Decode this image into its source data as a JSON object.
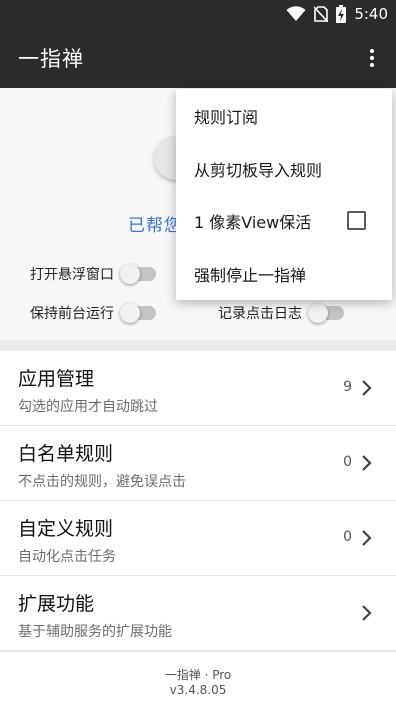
{
  "status_bar": {
    "time": "5:40",
    "icons": [
      "wifi-icon",
      "no-sim-icon",
      "battery-charging-icon"
    ]
  },
  "app_bar": {
    "title": "一指禅",
    "more_icon": "more-vert-icon"
  },
  "main": {
    "helped_text": "已帮您",
    "settings": {
      "floating_window": "打开悬浮窗口",
      "keep_foreground": "保持前台运行",
      "log_clicks": "记录点击日志"
    }
  },
  "list": [
    {
      "title": "应用管理",
      "subtitle": "勾选的应用才自动跳过",
      "count": "9"
    },
    {
      "title": "白名单规则",
      "subtitle": "不点击的规则，避免误点击",
      "count": "0"
    },
    {
      "title": "自定义规则",
      "subtitle": "自动化点击任务",
      "count": "0"
    },
    {
      "title": "扩展功能",
      "subtitle": "基于辅助服务的扩展功能",
      "count": ""
    }
  ],
  "footer": {
    "app_name": "一指禅 · Pro",
    "version": "v3.4.8.05"
  },
  "overflow_menu": {
    "subscribe_rules": "规则订阅",
    "import_clipboard": "从剪切板导入规则",
    "keepalive_view": "1 像素View保活",
    "keepalive_checked": false,
    "force_stop": "强制停止一指禅"
  },
  "colors": {
    "app_bar": "#2b2b2b",
    "accent_blue": "#3b73d2",
    "background": "#ebebeb"
  }
}
